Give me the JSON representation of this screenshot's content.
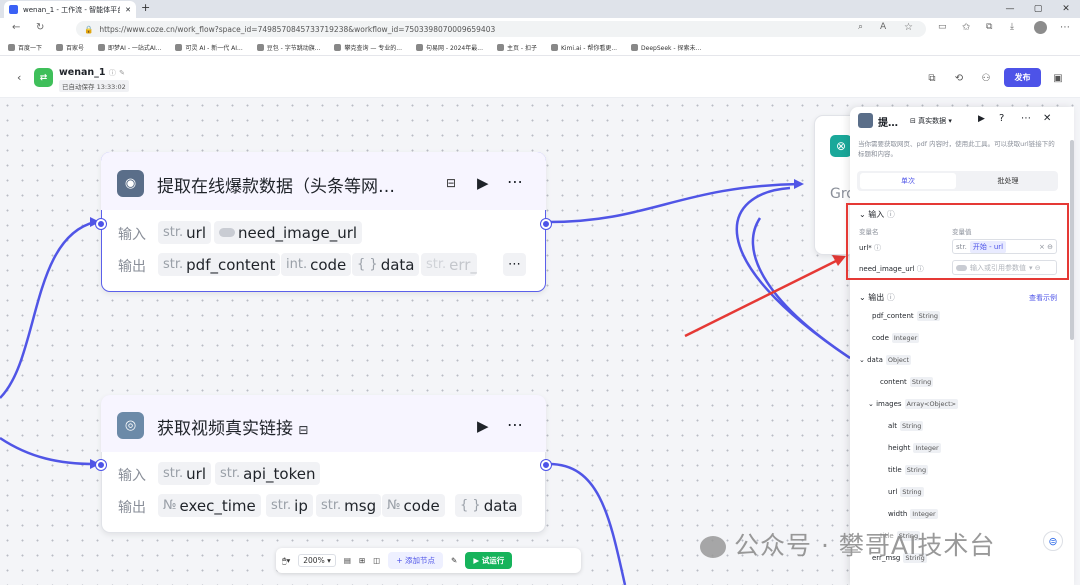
{
  "browser": {
    "tab_title": "wenan_1 - 工作流 - 智能体平台",
    "url": "https://www.coze.cn/work_flow?space_id=7498570845733719238&workflow_id=7503398070009659403",
    "bookmarks": [
      "百度一下",
      "百家号",
      "即梦AI - 一站式AI...",
      "可灵 AI - 新一代 AI...",
      "豆包 - 字节跳动旗...",
      "攀克查询 — 专业的...",
      "句易网 - 2024年最...",
      "主页 - 扣子",
      "Kimi.ai - 帮你看更...",
      "DeepSeek - 探索未..."
    ]
  },
  "header": {
    "title": "wenan_1",
    "autosave": "已自动保存 13:33:02",
    "publish_label": "发布"
  },
  "nodes": {
    "node1": {
      "title": "提取在线爆款数据（头条等网…",
      "input_label": "输入",
      "output_label": "输出",
      "inputs": [
        {
          "type": "str.",
          "name": "url"
        },
        {
          "type": "",
          "name": "need_image_url"
        }
      ],
      "outputs": [
        {
          "type": "str.",
          "name": "pdf_content"
        },
        {
          "type": "int.",
          "name": "code"
        },
        {
          "type": "{ }",
          "name": "data"
        },
        {
          "type": "str.",
          "name": "err_"
        }
      ]
    },
    "node2": {
      "title": "获取视频真实链接",
      "input_label": "输入",
      "output_label": "输出",
      "inputs": [
        {
          "type": "str.",
          "name": "url"
        },
        {
          "type": "str.",
          "name": "api_token"
        }
      ],
      "outputs": [
        {
          "type": "№",
          "name": "exec_time"
        },
        {
          "type": "str.",
          "name": "ip"
        },
        {
          "type": "str.",
          "name": "msg"
        },
        {
          "type": "№",
          "name": "code"
        },
        {
          "type": "{ }",
          "name": "data"
        }
      ]
    },
    "node3_title": "Gro"
  },
  "toolbar": {
    "zoom": "200%",
    "add_node": "+ 添加节点",
    "run": "试运行"
  },
  "panel": {
    "title": "提…",
    "data_mode": "真实数据",
    "description": "当你需要获取网页、pdf 内容时，使用此工具。可以获取url链接下的标题和内容。",
    "tabs": [
      "单次",
      "批处理"
    ],
    "input_section": "输入",
    "col_name": "变量名",
    "col_value": "变量值",
    "inputs": [
      {
        "name": "url*",
        "type": "str.",
        "value": "开始 - url"
      },
      {
        "name": "need_image_url",
        "placeholder": "输入或引用参数值"
      }
    ],
    "output_section": "输出",
    "view_example": "查看示例",
    "outputs": [
      {
        "name": "pdf_content",
        "type": "String",
        "indent": 0
      },
      {
        "name": "code",
        "type": "Integer",
        "indent": 0
      },
      {
        "name": "data",
        "type": "Object",
        "indent": 0
      },
      {
        "name": "content",
        "type": "String",
        "indent": 1
      },
      {
        "name": "images",
        "type": "Array<Object>",
        "indent": 1
      },
      {
        "name": "alt",
        "type": "String",
        "indent": 2
      },
      {
        "name": "height",
        "type": "Integer",
        "indent": 2
      },
      {
        "name": "title",
        "type": "String",
        "indent": 2
      },
      {
        "name": "url",
        "type": "String",
        "indent": 2
      },
      {
        "name": "width",
        "type": "Integer",
        "indent": 2
      },
      {
        "name": "title",
        "type": "String",
        "indent": 1
      },
      {
        "name": "err_msg",
        "type": "String",
        "indent": 0
      }
    ]
  },
  "watermark": "公众号 · 攀哥AI技术台",
  "colors": {
    "accent": "#4d53e8",
    "run": "#16b35b",
    "highlight": "#e53935"
  }
}
